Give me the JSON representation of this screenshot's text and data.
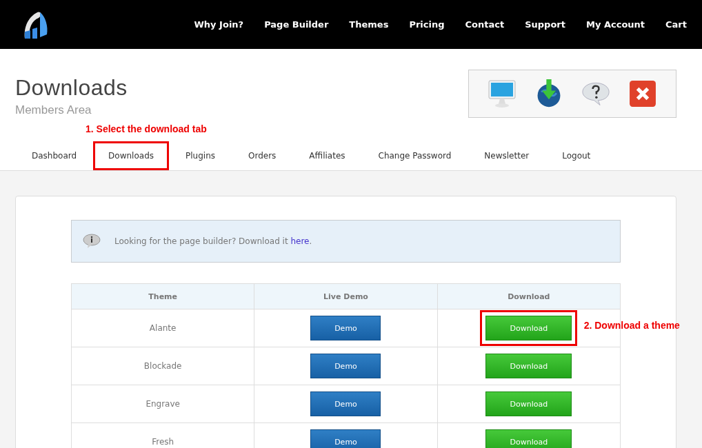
{
  "nav": {
    "items": [
      "Why Join?",
      "Page Builder",
      "Themes",
      "Pricing",
      "Contact",
      "Support",
      "My Account",
      "Cart"
    ]
  },
  "header": {
    "title": "Downloads",
    "subtitle": "Members Area"
  },
  "annotations": {
    "tabs": "1. Select the download tab",
    "download": "2. Download a theme"
  },
  "tabs": [
    {
      "label": "Dashboard",
      "selected": false
    },
    {
      "label": "Downloads",
      "selected": true
    },
    {
      "label": "Plugins",
      "selected": false
    },
    {
      "label": "Orders",
      "selected": false
    },
    {
      "label": "Affiliates",
      "selected": false
    },
    {
      "label": "Change Password",
      "selected": false
    },
    {
      "label": "Newsletter",
      "selected": false
    },
    {
      "label": "Logout",
      "selected": false
    }
  ],
  "notice": {
    "text": "Looking for the page builder? Download it ",
    "link": "here",
    "end": "."
  },
  "table": {
    "columns": [
      "Theme",
      "Live Demo",
      "Download"
    ],
    "rows": [
      {
        "theme": "Alante",
        "demo": "Demo",
        "download": "Download",
        "highlighted": true
      },
      {
        "theme": "Blockade",
        "demo": "Demo",
        "download": "Download",
        "highlighted": false
      },
      {
        "theme": "Engrave",
        "demo": "Demo",
        "download": "Download",
        "highlighted": false
      },
      {
        "theme": "Fresh",
        "demo": "Demo",
        "download": "Download",
        "highlighted": false
      }
    ]
  }
}
